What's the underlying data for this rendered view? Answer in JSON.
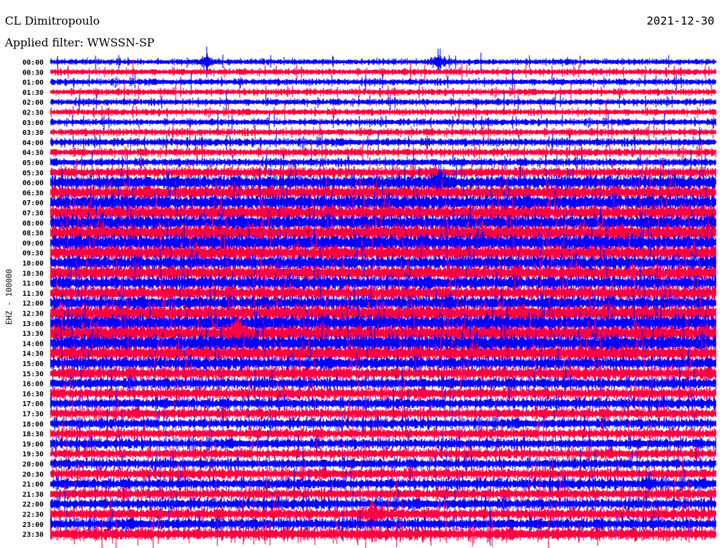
{
  "header": {
    "station": "CL Dimitropoulo",
    "filter_label": "Applied filter: WWSSN-SP",
    "date": "2021-12-30"
  },
  "chart_data": {
    "type": "line",
    "title": "CL Dimitropoulo",
    "subtitle": "Applied filter: WWSSN-SP",
    "ylabel": "EHZ - 100000",
    "colors": [
      "#0000ff",
      "#ff0040"
    ],
    "row_labels": [
      "00:00",
      "00:30",
      "01:00",
      "01:30",
      "02:00",
      "02:30",
      "03:00",
      "03:30",
      "04:00",
      "04:30",
      "05:00",
      "05:30",
      "06:00",
      "06:30",
      "07:00",
      "07:30",
      "08:00",
      "08:30",
      "09:00",
      "09:30",
      "10:00",
      "10:30",
      "11:00",
      "11:30",
      "12:00",
      "12:30",
      "13:00",
      "13:30",
      "14:00",
      "14:30",
      "15:00",
      "15:30",
      "16:00",
      "16:30",
      "17:00",
      "17:30",
      "18:00",
      "18:30",
      "19:00",
      "19:30",
      "20:00",
      "20:30",
      "21:00",
      "21:30",
      "22:00",
      "22:30",
      "23:00",
      "23:30"
    ],
    "relative_amplitude": [
      0.45,
      0.5,
      0.5,
      0.5,
      0.5,
      0.5,
      0.5,
      0.55,
      0.6,
      0.6,
      0.6,
      0.8,
      1.1,
      1.1,
      1.2,
      1.2,
      1.2,
      1.3,
      1.3,
      1.2,
      1.1,
      1.2,
      1.1,
      1.1,
      1.1,
      1.3,
      1.3,
      1.3,
      1.3,
      1.2,
      1.0,
      1.0,
      0.9,
      0.9,
      0.85,
      0.85,
      0.8,
      0.8,
      0.8,
      0.8,
      0.8,
      0.85,
      0.85,
      0.85,
      0.85,
      0.9,
      0.9,
      1.0
    ],
    "events": [
      {
        "row": 0,
        "minute": 7,
        "amplitude": 3.5
      },
      {
        "row": 0,
        "minute": 17.5,
        "amplitude": 4
      },
      {
        "row": 12,
        "minute": 17.5,
        "amplitude": 3
      },
      {
        "row": 27,
        "minute": 8.5,
        "amplitude": 2.5
      },
      {
        "row": 24,
        "minute": 18,
        "amplitude": 2
      },
      {
        "row": 42,
        "minute": 27,
        "amplitude": 2.5
      },
      {
        "row": 45,
        "minute": 14.5,
        "amplitude": 3
      }
    ],
    "duration_per_row_minutes": 30
  }
}
